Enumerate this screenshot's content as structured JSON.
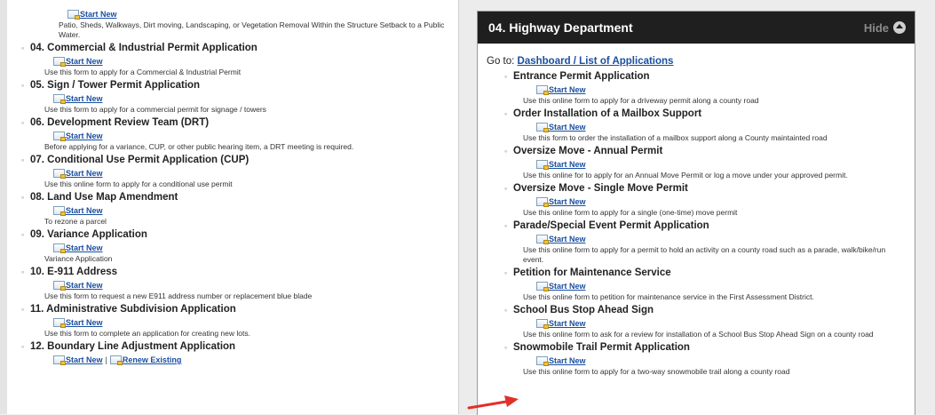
{
  "left": {
    "top_item": {
      "start_label": "Start New",
      "description": "Patio, Sheds, Walkways, Dirt moving, Landscaping, or Vegetation Removal Within the Structure Setback to a Public Water."
    },
    "items": [
      {
        "title": "04. Commercial & Industrial Permit Application",
        "start_label": "Start New",
        "description": "Use this form to apply for a Commercial & Industrial Permit"
      },
      {
        "title": "05. Sign / Tower Permit Application",
        "start_label": "Start New",
        "description": "Use this form to apply for a commercial permit for signage / towers"
      },
      {
        "title": "06. Development Review Team (DRT)",
        "start_label": "Start New",
        "description": "Before applying for a variance, CUP, or other public hearing item, a DRT meeting is required."
      },
      {
        "title": "07. Conditional Use Permit Application (CUP)",
        "start_label": "Start New",
        "description": "Use this online form to apply for a conditional use permit"
      },
      {
        "title": "08. Land Use Map Amendment",
        "start_label": "Start New",
        "description": "To rezone a parcel"
      },
      {
        "title": "09. Variance Application",
        "start_label": "Start New",
        "description": "Variance Application"
      },
      {
        "title": "10. E-911 Address",
        "start_label": "Start New",
        "description": "Use this form to request a new E911 address number or replacement blue blade"
      },
      {
        "title": "11. Administrative Subdivision Application",
        "start_label": "Start New",
        "description": "Use this form to complete an application for creating new lots."
      },
      {
        "title": "12. Boundary Line Adjustment Application",
        "start_label": "Start New",
        "renew_label": "Renew Existing",
        "separator": "|"
      }
    ]
  },
  "right": {
    "header": {
      "title": "04. Highway Department",
      "hide_label": "Hide"
    },
    "goto_prefix": "Go to:",
    "goto_link": "Dashboard / List of Applications",
    "items": [
      {
        "title": "Entrance Permit Application",
        "start_label": "Start New",
        "description": "Use this online form to apply for a driveway permit along a county road"
      },
      {
        "title": "Order Installation of a Mailbox Support",
        "start_label": "Start New",
        "description": "Use this form to order the installation of a mailbox support along a County maintainted road"
      },
      {
        "title": "Oversize Move - Annual Permit",
        "start_label": "Start New",
        "description": "Use this online for to apply for an Annual Move Permit or log a move under your approved permit."
      },
      {
        "title": "Oversize Move - Single Move Permit",
        "start_label": "Start New",
        "description": "Use this online form to apply for a single (one-time) move permit"
      },
      {
        "title": "Parade/Special Event Permit Application",
        "start_label": "Start New",
        "description": "Use this online form to apply for a permit to hold an activity on a county road such as a parade, walk/bike/run event."
      },
      {
        "title": "Petition for Maintenance Service",
        "start_label": "Start New",
        "description": "Use this online form to petition for maintenance service in the First Assessment District."
      },
      {
        "title": "School Bus Stop Ahead Sign",
        "start_label": "Start New",
        "description": "Use this online form to ask for a review for installation of a School Bus Stop Ahead Sign on a county road"
      },
      {
        "title": "Snowmobile Trail Permit Application",
        "start_label": "Start New",
        "description": "Use this online form to apply for a two-way snowmobile trail along a county road"
      }
    ]
  },
  "colors": {
    "link": "#1a4fa0",
    "header_bg": "#1f1f1f",
    "arrow": "#e0302a"
  },
  "icons": {
    "start": "form-icon",
    "renew": "renew-icon",
    "hide": "collapse-icon",
    "pointer": "red-arrow-annotation"
  }
}
